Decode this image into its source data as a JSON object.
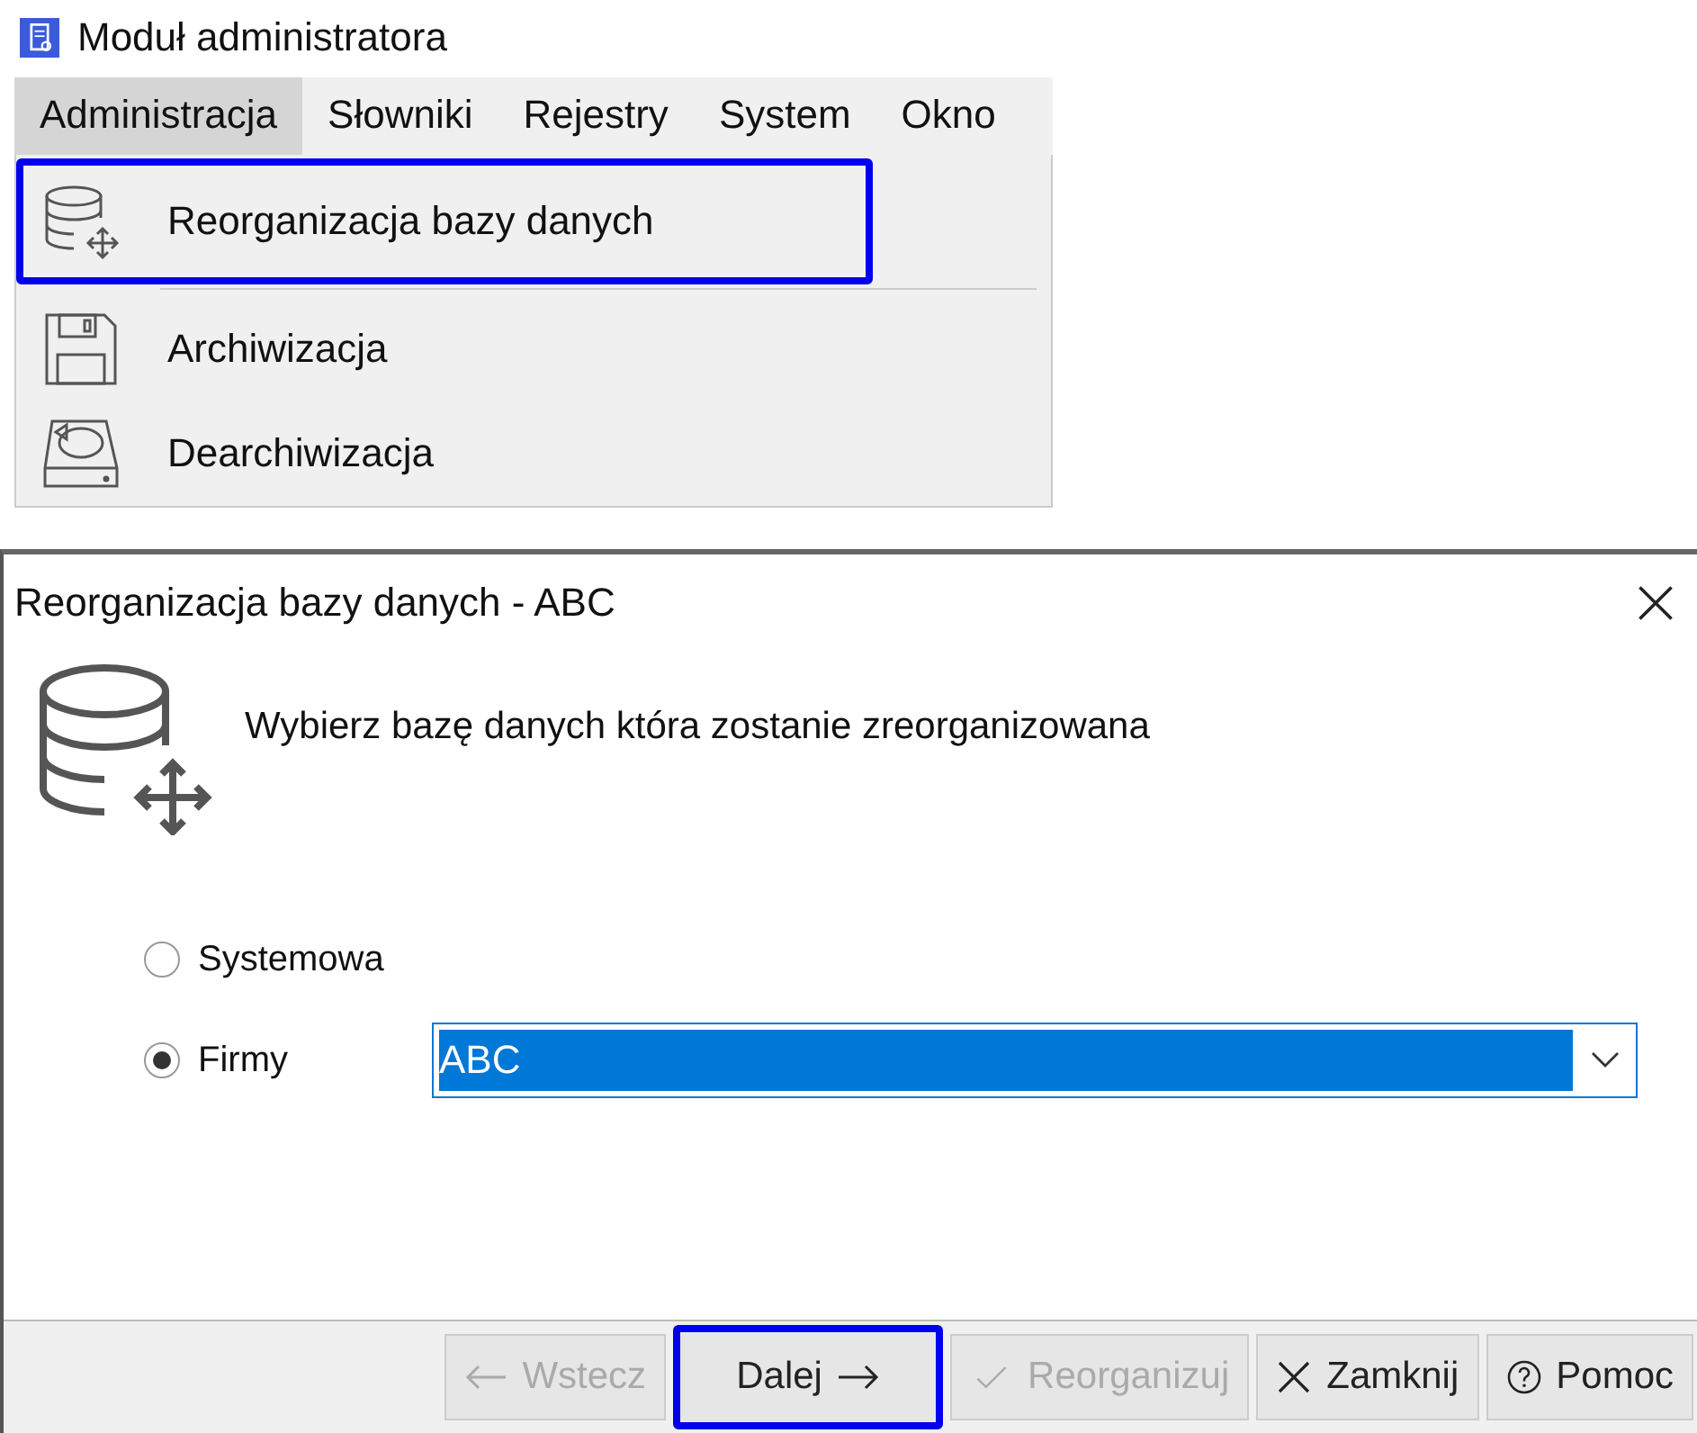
{
  "app_window": {
    "title": "Moduł administratora"
  },
  "menu_bar": [
    {
      "label": "Administracja",
      "selected": true
    },
    {
      "label": "Słowniki",
      "selected": false
    },
    {
      "label": "Rejestry",
      "selected": false
    },
    {
      "label": "System",
      "selected": false
    },
    {
      "label": "Okno",
      "selected": false
    }
  ],
  "menu": [
    {
      "label": "Reorganizacja bazy danych",
      "kind": "database",
      "highlighted": true
    },
    {
      "kind": "separator"
    },
    {
      "label": "Archiwizacja",
      "kind": "save",
      "highlighted": false
    },
    {
      "label": "Dearchiwizacja",
      "kind": "restore",
      "highlighted": false
    }
  ],
  "dialog": {
    "title": "Reorganizacja bazy danych - ABC",
    "message": "Wybierz bazę danych która zostanie zreorganizowana",
    "options": [
      {
        "label": "Systemowa",
        "selected": false
      },
      {
        "label": "Firmy",
        "selected": true
      }
    ],
    "company_select": {
      "value": "ABC"
    },
    "buttons": [
      {
        "label": "Wstecz",
        "kind": "back",
        "disabled": true,
        "highlighted": false
      },
      {
        "label": "Dalej",
        "kind": "next",
        "disabled": false,
        "highlighted": true
      },
      {
        "label": "Reorganizuj",
        "kind": "check",
        "disabled": true,
        "highlighted": false
      },
      {
        "label": "Zamknij",
        "kind": "close",
        "disabled": false,
        "highlighted": false
      },
      {
        "label": "Pomoc",
        "kind": "help",
        "disabled": false,
        "highlighted": false
      }
    ]
  }
}
